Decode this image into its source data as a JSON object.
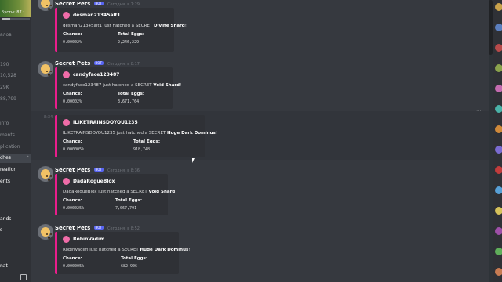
{
  "sidebar": {
    "boost_label": "Бусты: 87 ›",
    "boost_progress": 0.3,
    "rows": [
      {
        "text": "алов",
        "style": "normal"
      },
      {
        "text": "190",
        "style": "normal"
      },
      {
        "text": "10,528",
        "style": "normal"
      },
      {
        "text": "29K",
        "style": "normal"
      },
      {
        "text": "88,799",
        "style": "normal"
      },
      {
        "text": "info",
        "style": "normal"
      },
      {
        "text": "ments",
        "style": "normal"
      },
      {
        "text": "plication",
        "style": "normal"
      },
      {
        "text": "ches",
        "style": "selected"
      },
      {
        "text": "reation",
        "style": "bright"
      },
      {
        "text": "ents",
        "style": "bright"
      },
      {
        "text": "ands",
        "style": "bright"
      },
      {
        "text": "s",
        "style": "bright"
      },
      {
        "text": "nat",
        "style": "bright"
      }
    ]
  },
  "messages": [
    {
      "author": "Secret Pets",
      "bot_tag": "BOT",
      "timestamp": "Сегодня, в 7:29",
      "embed": {
        "username": "desman21345alt1",
        "desc_prefix": "desman21345alt1 just hatched a SECRET ",
        "pet": "Divine Shard",
        "desc_suffix": "!",
        "chance_label": "Chance:",
        "chance": "0.00002%",
        "eggs_label": "Total Eggs:",
        "eggs": "2,246,229"
      }
    },
    {
      "author": "Secret Pets",
      "bot_tag": "BOT",
      "timestamp": "Сегодня, в 8:17",
      "embed": {
        "username": "candyface123487",
        "desc_prefix": "candyface123487 just hatched a SECRET ",
        "pet": "Void Shard",
        "desc_suffix": "!",
        "chance_label": "Chance:",
        "chance": "0.00002%",
        "eggs_label": "Total Eggs:",
        "eggs": "3,671,764"
      }
    },
    {
      "side_time": "8:34",
      "embed": {
        "username": "ILIKETRAINSDOYOU1235",
        "desc_prefix": "ILIKETRAINSDOYOU1235 just hatched a SECRET ",
        "pet": "Huge Dark Dominus",
        "desc_suffix": "!",
        "chance_label": "Chance:",
        "chance": "0.000005%",
        "eggs_label": "Total Eggs:",
        "eggs": "918,748"
      }
    },
    {
      "author": "Secret Pets",
      "bot_tag": "BOT",
      "timestamp": "Сегодня, в 8:36",
      "embed": {
        "username": "DadaRogueBlox",
        "desc_prefix": "DadaRogueBlox just hatched a SECRET ",
        "pet": "Void Shard",
        "desc_suffix": "!",
        "chance_label": "Chance:",
        "chance": "0.000025%",
        "eggs_label": "Total Eggs:",
        "eggs": "7,067,791"
      }
    },
    {
      "author": "Secret Pets",
      "bot_tag": "BOT",
      "timestamp": "Сегодня, в 8:52",
      "embed": {
        "username": "RobinVadim",
        "desc_prefix": "RobinVadim just hatched a SECRET ",
        "pet": "Huge Dark Dominus",
        "desc_suffix": "!",
        "chance_label": "Chance:",
        "chance": "0.000005%",
        "eggs_label": "Total Eggs:",
        "eggs": "682,906"
      }
    }
  ],
  "toolbar": {
    "more_icon": "⋯"
  },
  "colors": {
    "embed_accent": "#e91e8c",
    "bot_tag": "#5865f2",
    "avatar_face": "#f2c265"
  }
}
